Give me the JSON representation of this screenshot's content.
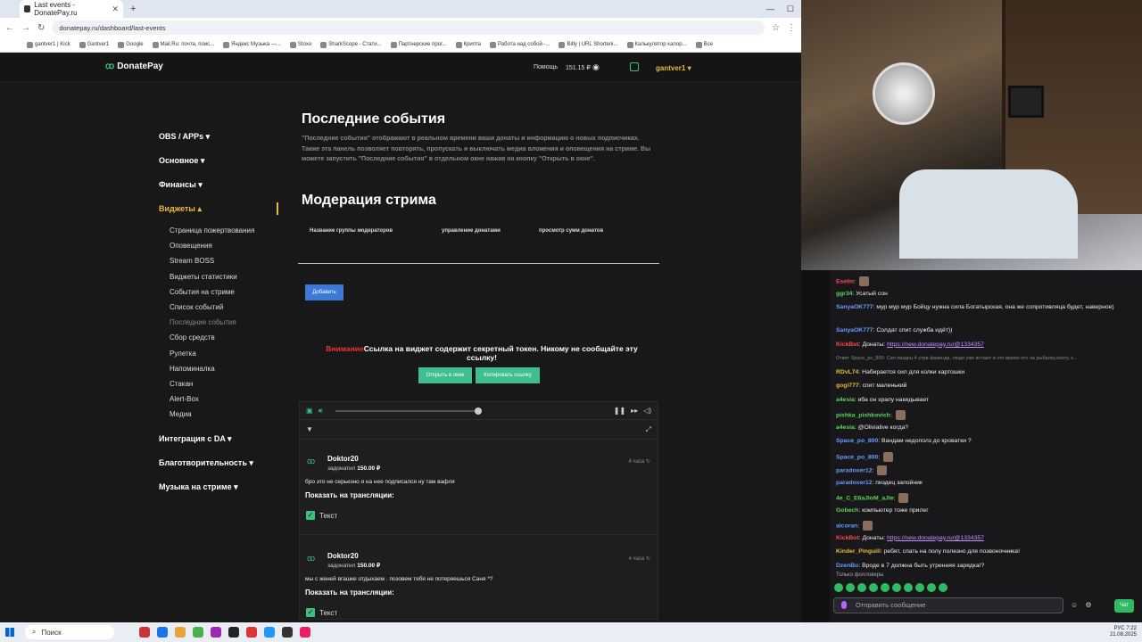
{
  "browser": {
    "tab_title": "Last events - DonatePay.ru",
    "url": "donatepay.ru/dashboard/last-events",
    "bookmarks": [
      "gantver1 | Kick",
      "Gantver1",
      "Google",
      "Mail.Ru: почта, поис...",
      "Яндекс Музыка —...",
      "Stoxo",
      "SharkScope - Стати...",
      "Партнерские прог...",
      "Крипта",
      "Работа над собой -...",
      "Bitly | URL Shorteni...",
      "Калькулятор калор...",
      "Все"
    ]
  },
  "site": {
    "logo": "DonatePay",
    "help": "Помощь",
    "balance": "151.15 ₽",
    "user": "gantver1 ▾"
  },
  "sidebar": {
    "items": [
      {
        "label": "OBS / APPs ▾"
      },
      {
        "label": "Основное ▾"
      },
      {
        "label": "Финансы ▾"
      },
      {
        "label": "Виджеты ▴"
      }
    ],
    "widgets": [
      "Страница пожертвования",
      "Оповещения",
      "Stream BOSS",
      "Виджеты статистики",
      "События на стриме",
      "Список событий",
      "Последние события",
      "Сбор средств",
      "Рулетка",
      "Напоминалка",
      "Стакан",
      "Alert-Box",
      "Медиа"
    ],
    "after": [
      "Интеграция с DA ▾",
      "Благотворительность ▾",
      "Музыка на стриме ▾"
    ]
  },
  "main": {
    "title": "Последние события",
    "description": "\"Последние события\" отображают в реальном времени ваши донаты и информацию о новых подписчиках. Также эта панель позволяет повторять, пропускать и выключать медиа вложения и оповещения на стриме. Вы можете запустить \"Последние события\" в отдельном окне нажав на кнопку \"Открыть в окне\".",
    "moderation_title": "Модерация стрима",
    "mod_columns": [
      "Название группы модераторов",
      "управление донатами",
      "просмотр сумм донатов"
    ],
    "add_button": "Добавить",
    "warning_word": "Внимание",
    "warning_text": "Ссылка на виджет содержит секретный токен. Никому не сообщайте эту ссылку!",
    "open_button": "Открыть в окне",
    "copy_button": "Копировать ссылку"
  },
  "events": [
    {
      "name": "Doktor20",
      "donated_label": "задонатил",
      "amount": "150.00 ₽",
      "time": "4 часа",
      "message": "бро это не серьезно я на нее подписался ну там вафля",
      "show_label": "Показать на трансляции:",
      "check_label": "Текст"
    },
    {
      "name": "Doktor20",
      "donated_label": "задонатил",
      "amount": "150.00 ₽",
      "time": "4 часа",
      "message": "мы с женей вгашке отдыхаем . позовем тебя не потеряешься Саня *?",
      "show_label": "Показать на трансляции:",
      "check_label": "Текст"
    }
  ],
  "chat": {
    "messages": [
      {
        "user": "Eselin",
        "color": "#ff4a4a",
        "text": ""
      },
      {
        "user": "ggr34",
        "color": "#5cd65c",
        "text": "Усатый сон"
      },
      {
        "user": "SanyaOK777",
        "color": "#6d9cff",
        "text": "мур мур мур       Бойцу нужна сила Богатырская, она же сопротивляца будет, наверное)"
      },
      {
        "user": "SanyaOK777",
        "color": "#6d9cff",
        "text": "Солдат спит служба идёт))"
      },
      {
        "user": "KickBot",
        "color": "#ff4a4a",
        "text": "Донаты: ",
        "link": "https://new.donatepay.ru/@1334357"
      },
      {
        "user": "",
        "color": "#888",
        "text": "Ответ Space_po_800: Сап пиздец 4 утра фазенда, люди уже встают в это время кто на рыбалку,охоту, к..."
      },
      {
        "user": "RDvL74",
        "color": "#e8b93a",
        "text": "Набирается сил для колки картошки"
      },
      {
        "user": "gogi777",
        "color": "#e8b93a",
        "text": "спит маленький"
      },
      {
        "user": "a4esia",
        "color": "#5cd65c",
        "text": "еба он храпу накидывает"
      },
      {
        "user": "pishka_pishkovich",
        "color": "#5cd65c",
        "text": ""
      },
      {
        "user": "a4esia",
        "color": "#5cd65c",
        "text": "@Olivialive когда?"
      },
      {
        "user": "Space_po_800",
        "color": "#6d9cff",
        "text": "Вандам недополз до кроватки ?"
      },
      {
        "user": "Space_po_800",
        "color": "#6d9cff",
        "text": ""
      },
      {
        "user": "paradoxer12",
        "color": "#6d9cff",
        "text": ""
      },
      {
        "user": "paradoxer12",
        "color": "#6d9cff",
        "text": "пиздец запойник"
      },
      {
        "user": "4e_C_E6aJloM_aJle",
        "color": "#5cd65c",
        "text": ""
      },
      {
        "user": "Gobech",
        "color": "#5cd65c",
        "text": "компьютер тоже прилег"
      },
      {
        "user": "alcoran",
        "color": "#6d9cff",
        "text": ""
      },
      {
        "user": "KickBot",
        "color": "#ff4a4a",
        "text": "Донаты: ",
        "link": "https://new.donatepay.ru/@1334357"
      },
      {
        "user": "Kinder_Pinguili",
        "color": "#e8b93a",
        "text": "ребят, спать на полу полезно для позвоночника!"
      },
      {
        "user": "DzenBo",
        "color": "#6d9cff",
        "text": "Вроде в 7 должна быть утренняя зарядка!?"
      }
    ],
    "followers_only": "Только фолловеры",
    "input_placeholder": "Отправить сообщение",
    "send_button": "Чат"
  },
  "taskbar": {
    "search": "Поиск",
    "lang": "РУС",
    "time": "7:22",
    "date": "21.08.2025"
  }
}
